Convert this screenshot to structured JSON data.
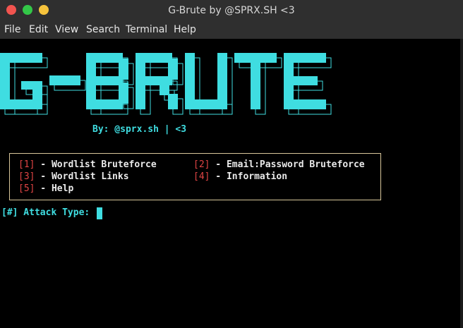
{
  "window": {
    "title": "G-Brute by @SPRX.SH <3"
  },
  "menubar": {
    "items": [
      "File",
      "Edit",
      "View",
      "Search",
      "Terminal",
      "Help"
    ]
  },
  "terminal": {
    "logo_text": "G-BRUTE",
    "credit": "By: @sprx.sh | <3",
    "options": [
      {
        "num": "[1]",
        "label": " - Wordlist Bruteforce"
      },
      {
        "num": "[2]",
        "label": " - Email:Password Bruteforce"
      },
      {
        "num": "[3]",
        "label": " - Wordlist Links"
      },
      {
        "num": "[4]",
        "label": " - Information"
      },
      {
        "num": "[5]",
        "label": " - Help"
      }
    ],
    "prompt": "[#] Attack Type: "
  },
  "colors": {
    "accent": "#3fdde1",
    "option_number": "#e04444",
    "box_border": "#d8c69a",
    "background": "#000000",
    "chrome": "#2f2f2f"
  }
}
